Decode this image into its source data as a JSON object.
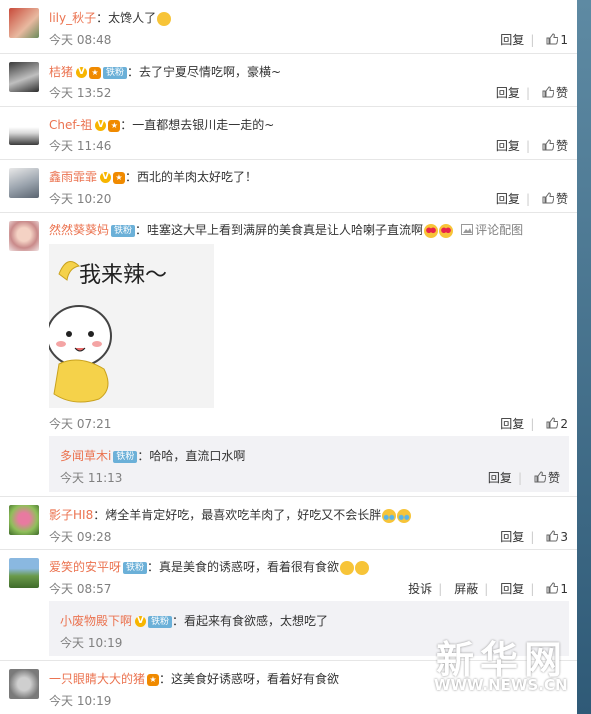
{
  "comments": [
    {
      "user": "lily_秋子",
      "sep": "：",
      "text": "太馋人了",
      "time": "今天 08:48",
      "reply_label": "回复",
      "like": "1"
    },
    {
      "user": "桔猪",
      "badge": "铁粉",
      "sep": "：",
      "text": "去了宁夏尽情吃啊，豪横~",
      "time": "今天 13:52",
      "reply_label": "回复",
      "like": "赞"
    },
    {
      "user": "Chef-祖",
      "sep": "：",
      "text": "一直都想去银川走一走的~",
      "time": "今天 11:46",
      "reply_label": "回复",
      "like": "赞"
    },
    {
      "user": "鑫雨霏霏",
      "sep": "：",
      "text": "西北的羊肉太好吃了！",
      "time": "今天 10:20",
      "reply_label": "回复",
      "like": "赞"
    },
    {
      "user": "然然葵葵妈",
      "badge": "铁粉",
      "sep": "：",
      "text": "哇塞这大早上看到满屏的美食真是让人哈喇子直流啊",
      "extra": "评论配图",
      "sticker_text": "我来辣～",
      "time": "今天 07:21",
      "reply_label": "回复",
      "like": "2"
    },
    {
      "user": "影子HI8",
      "sep": "：",
      "text": "烤全羊肯定好吃，最喜欢吃羊肉了，好吃又不会长胖",
      "time": "今天 09:28",
      "reply_label": "回复",
      "like": "3"
    },
    {
      "user": "爱笑的安平呀",
      "badge": "铁粉",
      "sep": "：",
      "text": "真是美食的诱惑呀，看着很有食欲",
      "time": "今天 08:57",
      "report_label": "投诉",
      "block_label": "屏蔽",
      "reply_label": "回复",
      "like": "1"
    },
    {
      "user": "一只眼睛大大的猪",
      "sep": "：",
      "text": "这美食好诱惑呀，看着好有食欲",
      "time": "今天 10:19"
    }
  ],
  "replies": [
    {
      "user": "多闻草木i",
      "badge": "铁粉",
      "sep": "：",
      "text": "哈哈，直流口水啊",
      "time": "今天 11:13",
      "reply_label": "回复",
      "like": "赞"
    },
    {
      "user": "小废物殿下啊",
      "badge": "铁粉",
      "sep": "：",
      "text": "看起来有食欲感，太想吃了",
      "time": "今天 10:19"
    }
  ],
  "badges": {
    "v": "V",
    "star": "★"
  },
  "watermark": {
    "logo": "新华网",
    "url": "WWW.NEWS.CN"
  }
}
